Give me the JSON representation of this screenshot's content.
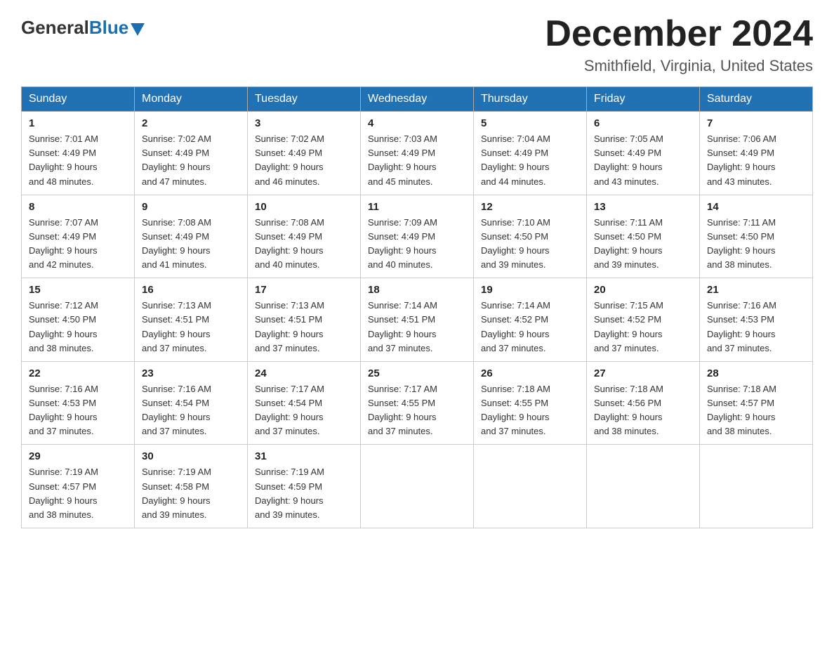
{
  "logo": {
    "general": "General",
    "blue": "Blue"
  },
  "title": {
    "month_year": "December 2024",
    "location": "Smithfield, Virginia, United States"
  },
  "days_of_week": [
    "Sunday",
    "Monday",
    "Tuesday",
    "Wednesday",
    "Thursday",
    "Friday",
    "Saturday"
  ],
  "weeks": [
    [
      {
        "day": "1",
        "sunrise": "7:01 AM",
        "sunset": "4:49 PM",
        "daylight": "9 hours and 48 minutes."
      },
      {
        "day": "2",
        "sunrise": "7:02 AM",
        "sunset": "4:49 PM",
        "daylight": "9 hours and 47 minutes."
      },
      {
        "day": "3",
        "sunrise": "7:02 AM",
        "sunset": "4:49 PM",
        "daylight": "9 hours and 46 minutes."
      },
      {
        "day": "4",
        "sunrise": "7:03 AM",
        "sunset": "4:49 PM",
        "daylight": "9 hours and 45 minutes."
      },
      {
        "day": "5",
        "sunrise": "7:04 AM",
        "sunset": "4:49 PM",
        "daylight": "9 hours and 44 minutes."
      },
      {
        "day": "6",
        "sunrise": "7:05 AM",
        "sunset": "4:49 PM",
        "daylight": "9 hours and 43 minutes."
      },
      {
        "day": "7",
        "sunrise": "7:06 AM",
        "sunset": "4:49 PM",
        "daylight": "9 hours and 43 minutes."
      }
    ],
    [
      {
        "day": "8",
        "sunrise": "7:07 AM",
        "sunset": "4:49 PM",
        "daylight": "9 hours and 42 minutes."
      },
      {
        "day": "9",
        "sunrise": "7:08 AM",
        "sunset": "4:49 PM",
        "daylight": "9 hours and 41 minutes."
      },
      {
        "day": "10",
        "sunrise": "7:08 AM",
        "sunset": "4:49 PM",
        "daylight": "9 hours and 40 minutes."
      },
      {
        "day": "11",
        "sunrise": "7:09 AM",
        "sunset": "4:49 PM",
        "daylight": "9 hours and 40 minutes."
      },
      {
        "day": "12",
        "sunrise": "7:10 AM",
        "sunset": "4:50 PM",
        "daylight": "9 hours and 39 minutes."
      },
      {
        "day": "13",
        "sunrise": "7:11 AM",
        "sunset": "4:50 PM",
        "daylight": "9 hours and 39 minutes."
      },
      {
        "day": "14",
        "sunrise": "7:11 AM",
        "sunset": "4:50 PM",
        "daylight": "9 hours and 38 minutes."
      }
    ],
    [
      {
        "day": "15",
        "sunrise": "7:12 AM",
        "sunset": "4:50 PM",
        "daylight": "9 hours and 38 minutes."
      },
      {
        "day": "16",
        "sunrise": "7:13 AM",
        "sunset": "4:51 PM",
        "daylight": "9 hours and 37 minutes."
      },
      {
        "day": "17",
        "sunrise": "7:13 AM",
        "sunset": "4:51 PM",
        "daylight": "9 hours and 37 minutes."
      },
      {
        "day": "18",
        "sunrise": "7:14 AM",
        "sunset": "4:51 PM",
        "daylight": "9 hours and 37 minutes."
      },
      {
        "day": "19",
        "sunrise": "7:14 AM",
        "sunset": "4:52 PM",
        "daylight": "9 hours and 37 minutes."
      },
      {
        "day": "20",
        "sunrise": "7:15 AM",
        "sunset": "4:52 PM",
        "daylight": "9 hours and 37 minutes."
      },
      {
        "day": "21",
        "sunrise": "7:16 AM",
        "sunset": "4:53 PM",
        "daylight": "9 hours and 37 minutes."
      }
    ],
    [
      {
        "day": "22",
        "sunrise": "7:16 AM",
        "sunset": "4:53 PM",
        "daylight": "9 hours and 37 minutes."
      },
      {
        "day": "23",
        "sunrise": "7:16 AM",
        "sunset": "4:54 PM",
        "daylight": "9 hours and 37 minutes."
      },
      {
        "day": "24",
        "sunrise": "7:17 AM",
        "sunset": "4:54 PM",
        "daylight": "9 hours and 37 minutes."
      },
      {
        "day": "25",
        "sunrise": "7:17 AM",
        "sunset": "4:55 PM",
        "daylight": "9 hours and 37 minutes."
      },
      {
        "day": "26",
        "sunrise": "7:18 AM",
        "sunset": "4:55 PM",
        "daylight": "9 hours and 37 minutes."
      },
      {
        "day": "27",
        "sunrise": "7:18 AM",
        "sunset": "4:56 PM",
        "daylight": "9 hours and 38 minutes."
      },
      {
        "day": "28",
        "sunrise": "7:18 AM",
        "sunset": "4:57 PM",
        "daylight": "9 hours and 38 minutes."
      }
    ],
    [
      {
        "day": "29",
        "sunrise": "7:19 AM",
        "sunset": "4:57 PM",
        "daylight": "9 hours and 38 minutes."
      },
      {
        "day": "30",
        "sunrise": "7:19 AM",
        "sunset": "4:58 PM",
        "daylight": "9 hours and 39 minutes."
      },
      {
        "day": "31",
        "sunrise": "7:19 AM",
        "sunset": "4:59 PM",
        "daylight": "9 hours and 39 minutes."
      },
      null,
      null,
      null,
      null
    ]
  ],
  "labels": {
    "sunrise": "Sunrise:",
    "sunset": "Sunset:",
    "daylight": "Daylight:"
  }
}
